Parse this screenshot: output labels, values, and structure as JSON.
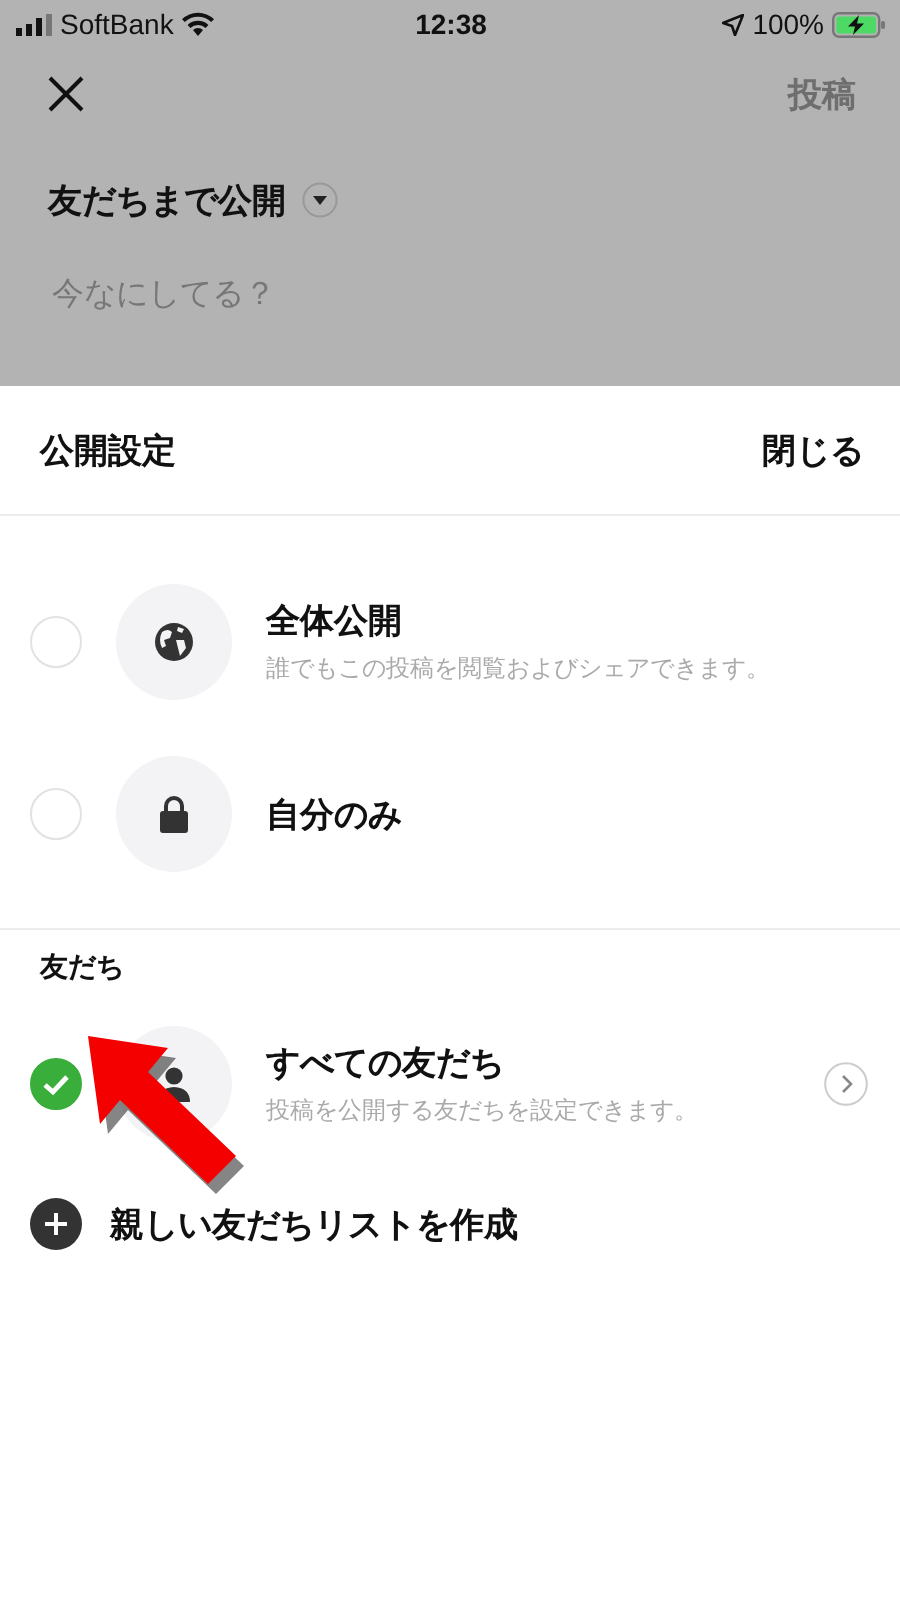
{
  "status_bar": {
    "carrier": "SoftBank",
    "time": "12:38",
    "battery": "100%"
  },
  "composer": {
    "post_button": "投稿",
    "audience": "友だちまで公開",
    "placeholder": "今なにしてる？"
  },
  "sheet": {
    "title": "公開設定",
    "close": "閉じる",
    "sections": [
      {
        "options": [
          {
            "kind": "globe",
            "title": "全体公開",
            "subtitle": "誰でもこの投稿を閲覧およびシェアできます。",
            "selected": false,
            "chevron": false
          },
          {
            "kind": "lock",
            "title": "自分のみ",
            "selected": false,
            "chevron": false
          }
        ]
      },
      {
        "label": "友だち",
        "options": [
          {
            "kind": "person",
            "title": "すべての友だち",
            "subtitle": "投稿を公開する友だちを設定できます。",
            "selected": true,
            "chevron": true
          }
        ]
      }
    ],
    "create_list": "親しい友だちリストを作成"
  }
}
